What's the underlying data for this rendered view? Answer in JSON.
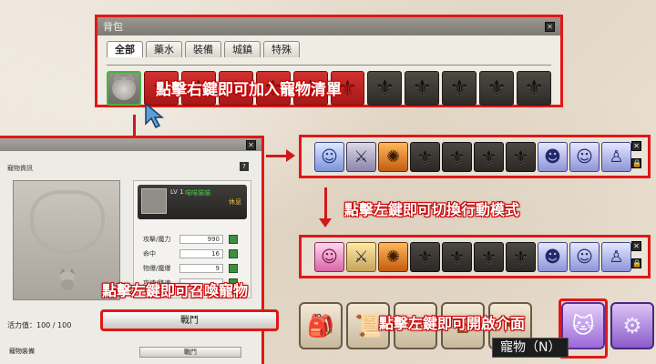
{
  "bag": {
    "title": "背包",
    "tabs": [
      "全部",
      "藥水",
      "裝備",
      "城鎮",
      "特殊"
    ],
    "active_tab": "全部",
    "callout": "點擊右鍵即可加入寵物清單"
  },
  "pet_info": {
    "subtitle": "寵物資訊",
    "level": "LV 1",
    "pet_name": "喵喵貓貓",
    "state": "休息",
    "stats": [
      {
        "label": "攻擊/魔力",
        "value": "990"
      },
      {
        "label": "命中",
        "value": "16"
      },
      {
        "label": "物爆/魔爆",
        "value": "9"
      },
      {
        "label": "攻速/移速",
        "value": ""
      }
    ],
    "vitality": "活力值：100 / 100",
    "slots_label": "寵物裝備",
    "battle_button": "戰鬥",
    "battle_button_small": "戰鬥",
    "callout": "點擊左鍵即可召喚寵物"
  },
  "quickbar": {
    "callout": "點擊左鍵即可切換行動模式"
  },
  "menu": {
    "tooltip": "寵物（N）",
    "callout": "點擊左鍵即可開啟介面"
  },
  "colors": {
    "highlight": "#e01818",
    "callout_outline": "#c40000",
    "pet_menu": "#9a6ad8"
  }
}
